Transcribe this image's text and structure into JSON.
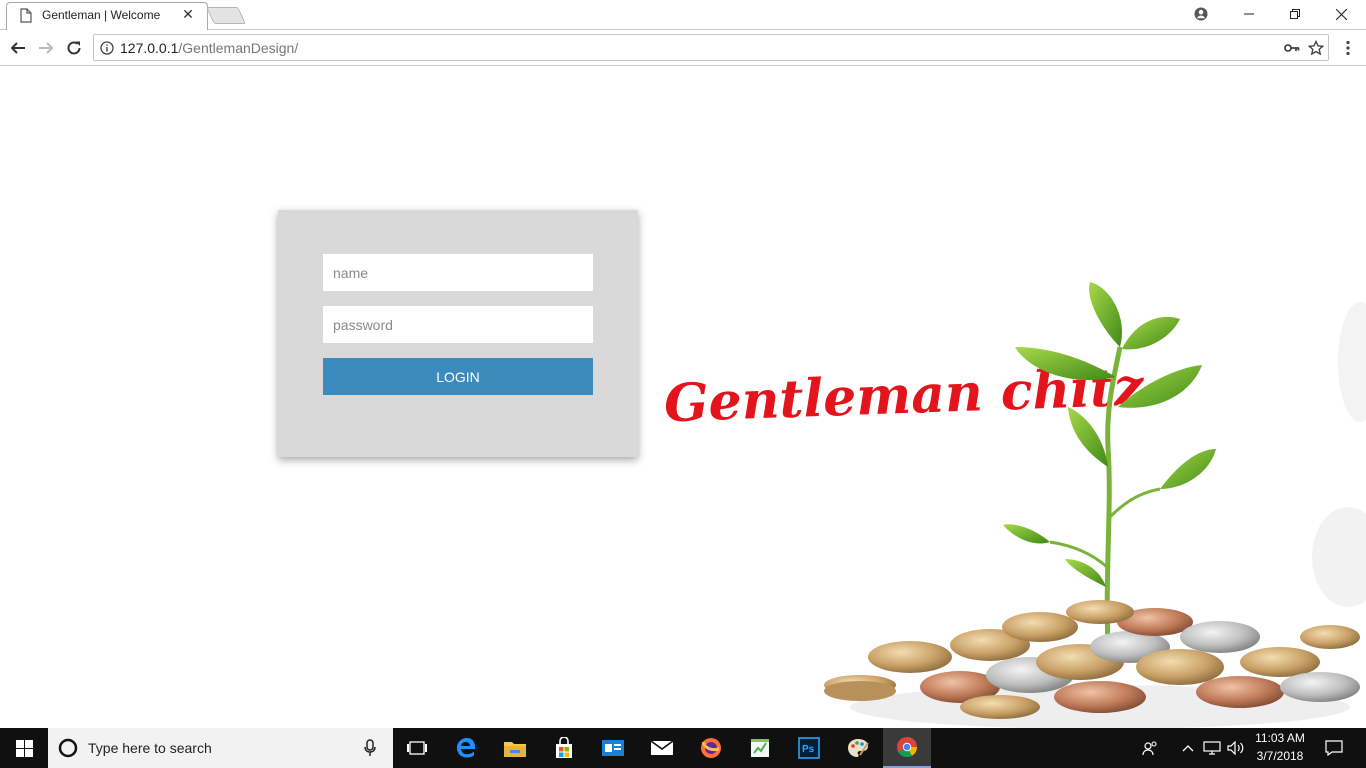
{
  "browser": {
    "tab_title": "Gentleman | Welcome",
    "tab_close": "✕",
    "url_host": "127.0.0.1",
    "url_path": "/GentlemanDesign/"
  },
  "login": {
    "name_placeholder": "name",
    "password_placeholder": "password",
    "button_label": "LOGIN"
  },
  "brand": {
    "text": "Gentleman chitz",
    "color": "#e3141b"
  },
  "colors": {
    "login_button": "#3b8bbd",
    "card_bg": "#d9d9d9"
  },
  "taskbar": {
    "search_placeholder": "Type here to search",
    "time": "11:03 AM",
    "date": "3/7/2018",
    "apps": [
      "task-view",
      "edge",
      "file-explorer",
      "store",
      "outlook",
      "mail",
      "firefox",
      "spreadsheet-app",
      "photoshop",
      "paint",
      "chrome"
    ]
  }
}
